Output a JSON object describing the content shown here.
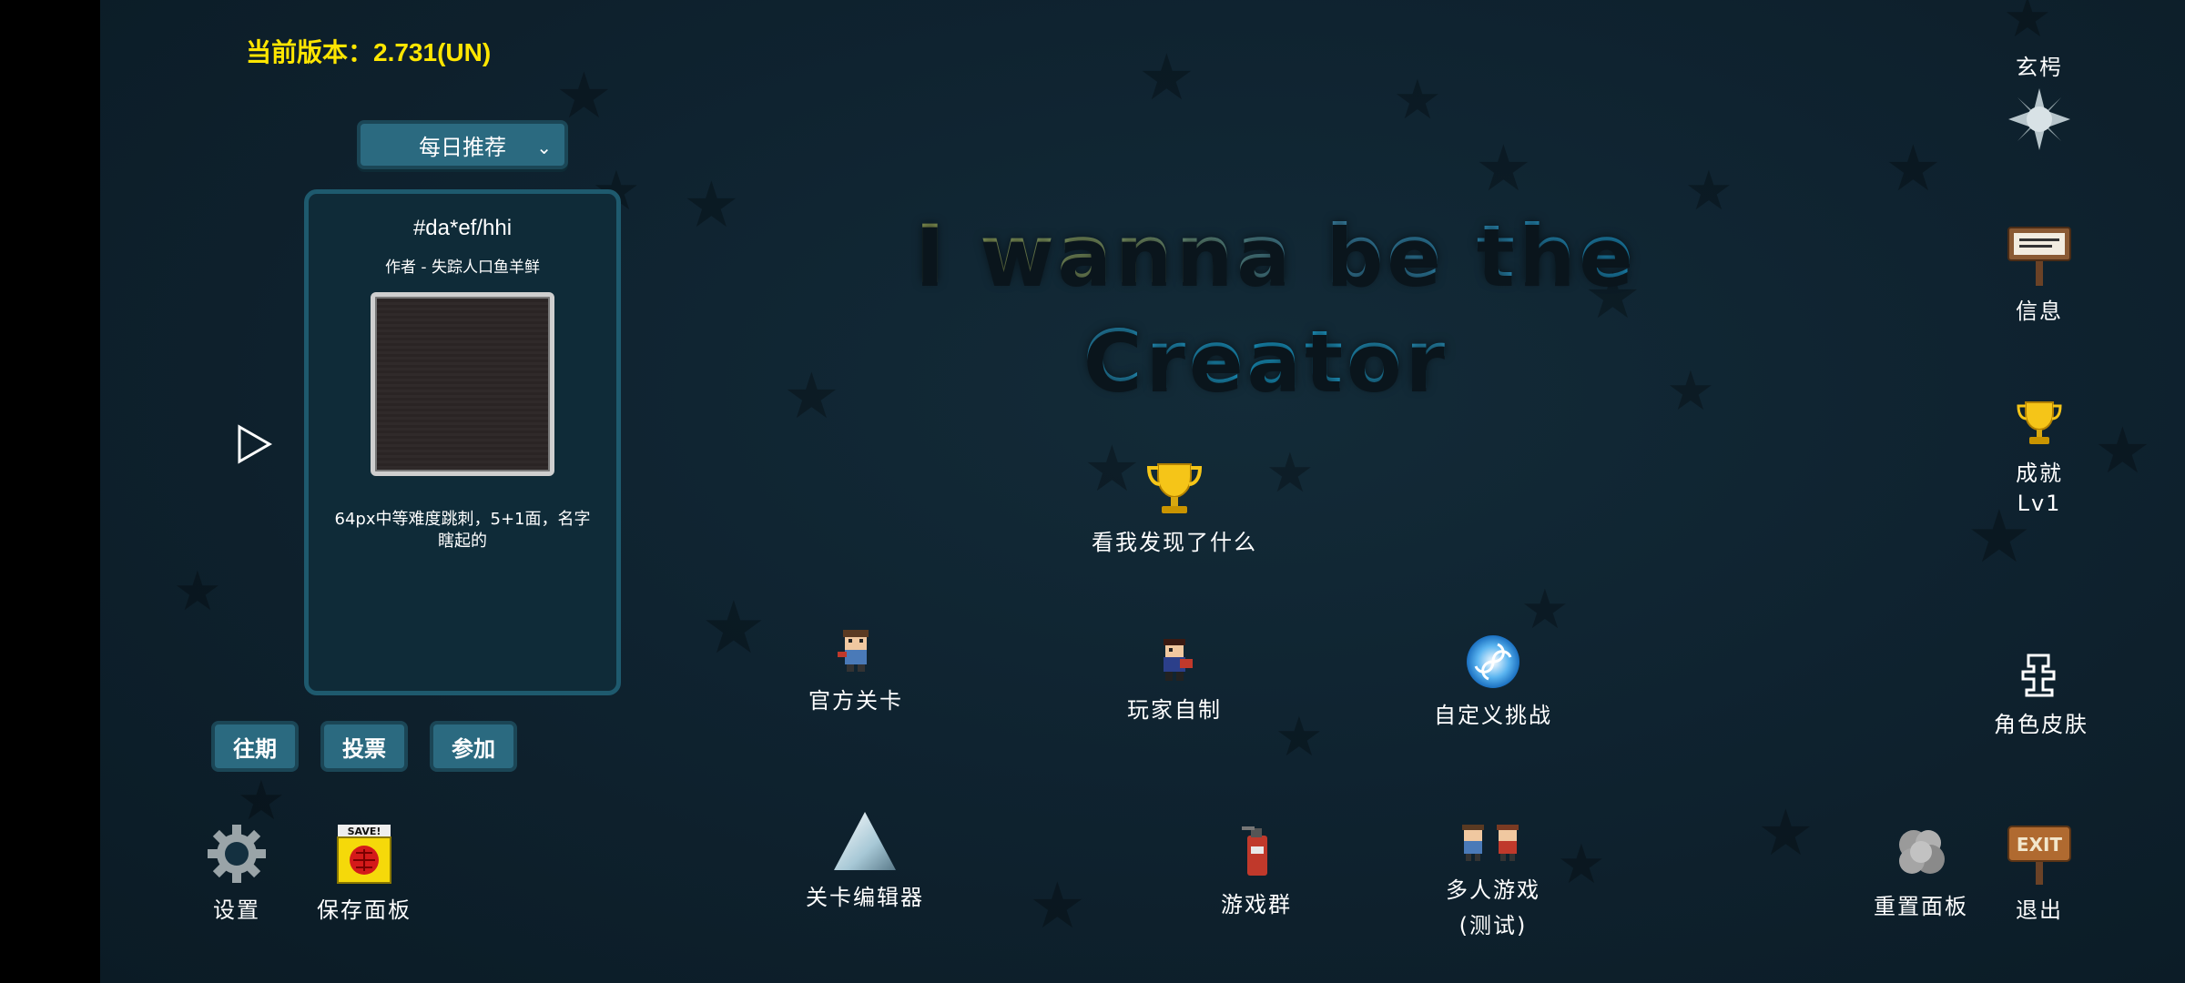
{
  "version_label": "当前版本：2.731(UN)",
  "daily": {
    "dropdown_label": "每日推荐",
    "level_title": "#da*ef/hhi",
    "author": "作者 - 失踪人口鱼羊鲜",
    "description": "64px中等难度跳刺，5+1面，名字瞎起的",
    "buttons": {
      "past": "往期",
      "vote": "投票",
      "join": "参加"
    }
  },
  "title": {
    "line1": "I wanna be the",
    "line2": "Creator"
  },
  "center": {
    "achievement_label": "看我发现了什么"
  },
  "menu": {
    "official_levels": "官方关卡",
    "player_made": "玩家自制",
    "custom_challenge": "自定义挑战",
    "level_editor": "关卡编辑器",
    "game_group": "游戏群",
    "multiplayer_line1": "多人游戏",
    "multiplayer_line2": "(测试)"
  },
  "right": {
    "xuanjie": "玄枵",
    "info": "信息",
    "achievements": "成就",
    "achievement_level": "Lv1",
    "skins": "角色皮肤",
    "reset_panel": "重置面板",
    "exit": "退出",
    "exit_sign_text": "EXIT"
  },
  "bottom_left": {
    "settings": "设置",
    "save_panel": "保存面板",
    "save_sign_text": "SAVE!"
  },
  "colors": {
    "version": "#ffe600",
    "panel_border": "#1e5a6e",
    "button": "#2b6a80"
  }
}
